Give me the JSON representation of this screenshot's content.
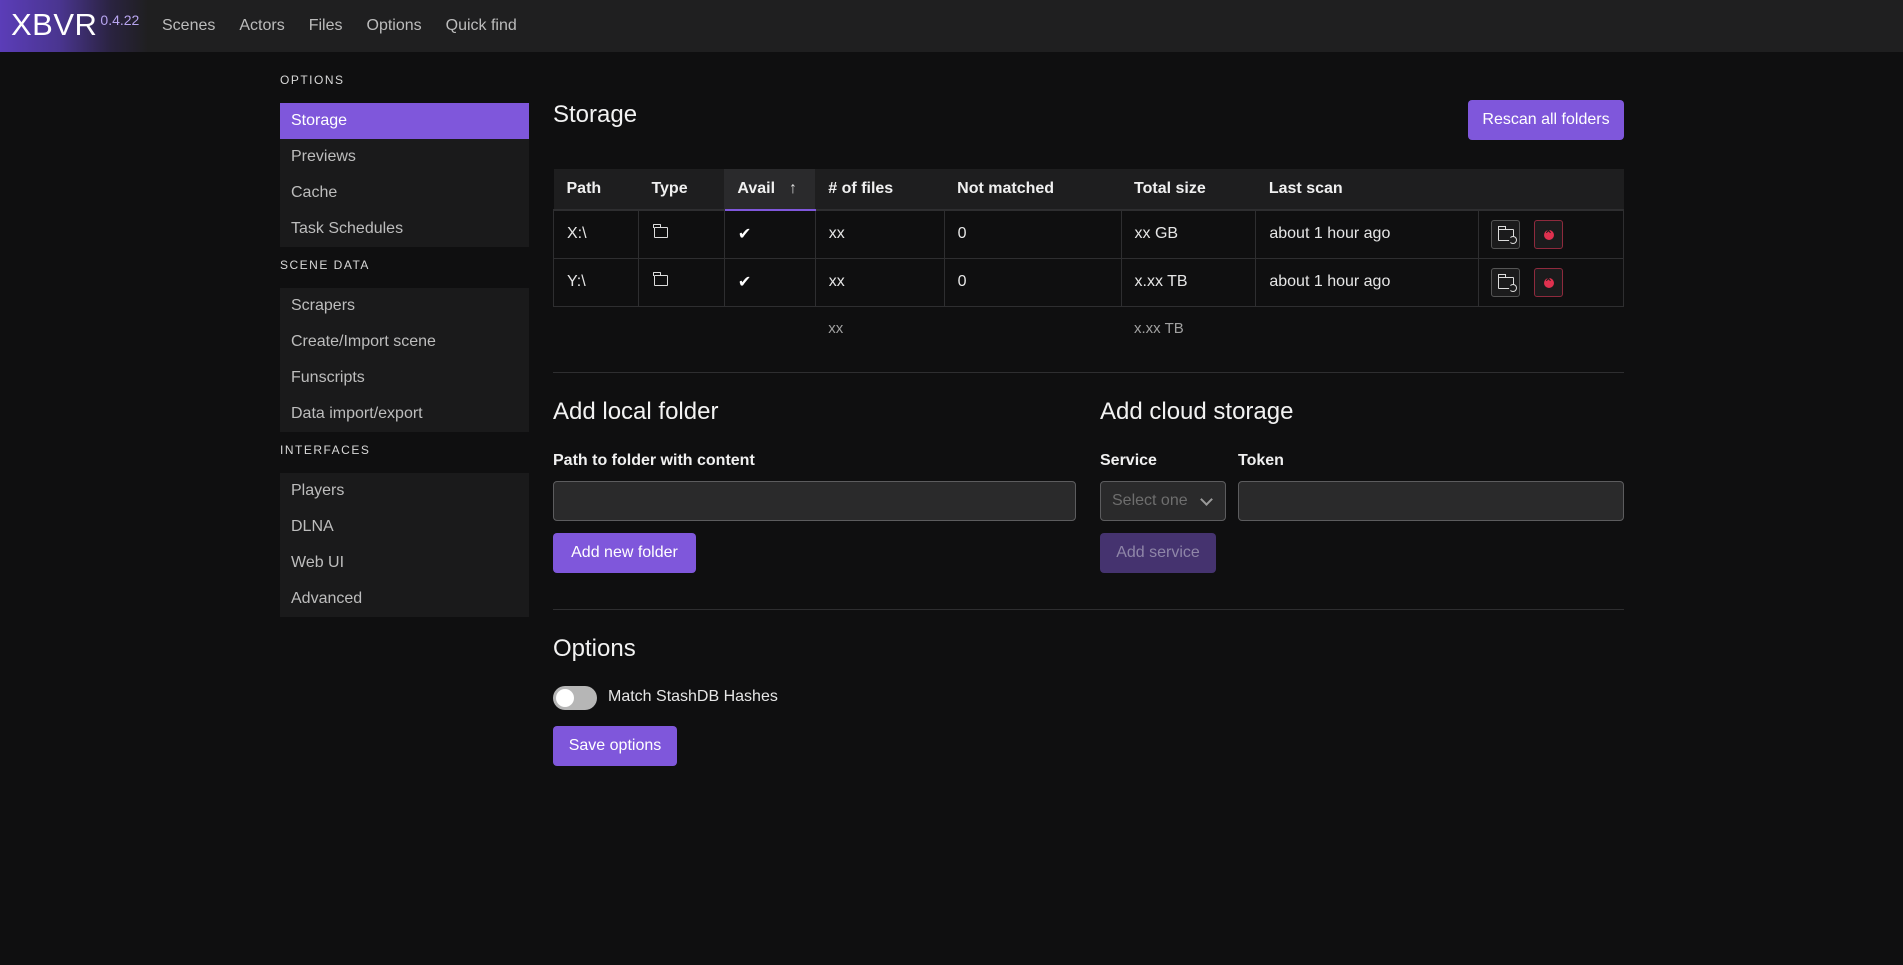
{
  "app": {
    "name": "XBVR",
    "version": "0.4.22"
  },
  "nav": {
    "items": [
      "Scenes",
      "Actors",
      "Files",
      "Options",
      "Quick find"
    ]
  },
  "sidebar": {
    "sections": [
      {
        "label": "OPTIONS",
        "items": [
          "Storage",
          "Previews",
          "Cache",
          "Task Schedules"
        ],
        "active": "Storage"
      },
      {
        "label": "SCENE DATA",
        "items": [
          "Scrapers",
          "Create/Import scene",
          "Funscripts",
          "Data import/export"
        ]
      },
      {
        "label": "INTERFACES",
        "items": [
          "Players",
          "DLNA",
          "Web UI",
          "Advanced"
        ]
      }
    ]
  },
  "storage": {
    "title": "Storage",
    "rescan_label": "Rescan all folders",
    "columns": [
      "Path",
      "Type",
      "Avail",
      "# of files",
      "Not matched",
      "Total size",
      "Last scan"
    ],
    "sort_column": "Avail",
    "rows": [
      {
        "path": "X:\\",
        "type_icon": "folder-icon",
        "avail": "✔",
        "files": "xx",
        "not_matched": "0",
        "total_size": "xx GB",
        "last_scan": "about 1 hour ago"
      },
      {
        "path": "Y:\\",
        "type_icon": "folder-icon",
        "avail": "✔",
        "files": "xx",
        "not_matched": "0",
        "total_size": "x.xx TB",
        "last_scan": "about 1 hour ago"
      }
    ],
    "totals": {
      "files": "xx",
      "total_size": "x.xx TB"
    }
  },
  "local_folder": {
    "title": "Add local folder",
    "path_label": "Path to folder with content",
    "path_value": "",
    "add_label": "Add new folder"
  },
  "cloud": {
    "title": "Add cloud storage",
    "service_label": "Service",
    "service_placeholder": "Select one",
    "token_label": "Token",
    "token_value": "",
    "add_label": "Add service"
  },
  "options": {
    "title": "Options",
    "toggle_label": "Match StashDB Hashes",
    "toggle_on": false,
    "save_label": "Save options"
  },
  "colors": {
    "accent": "#7f57db",
    "background": "#0f0f10",
    "danger": "#e0314f"
  }
}
